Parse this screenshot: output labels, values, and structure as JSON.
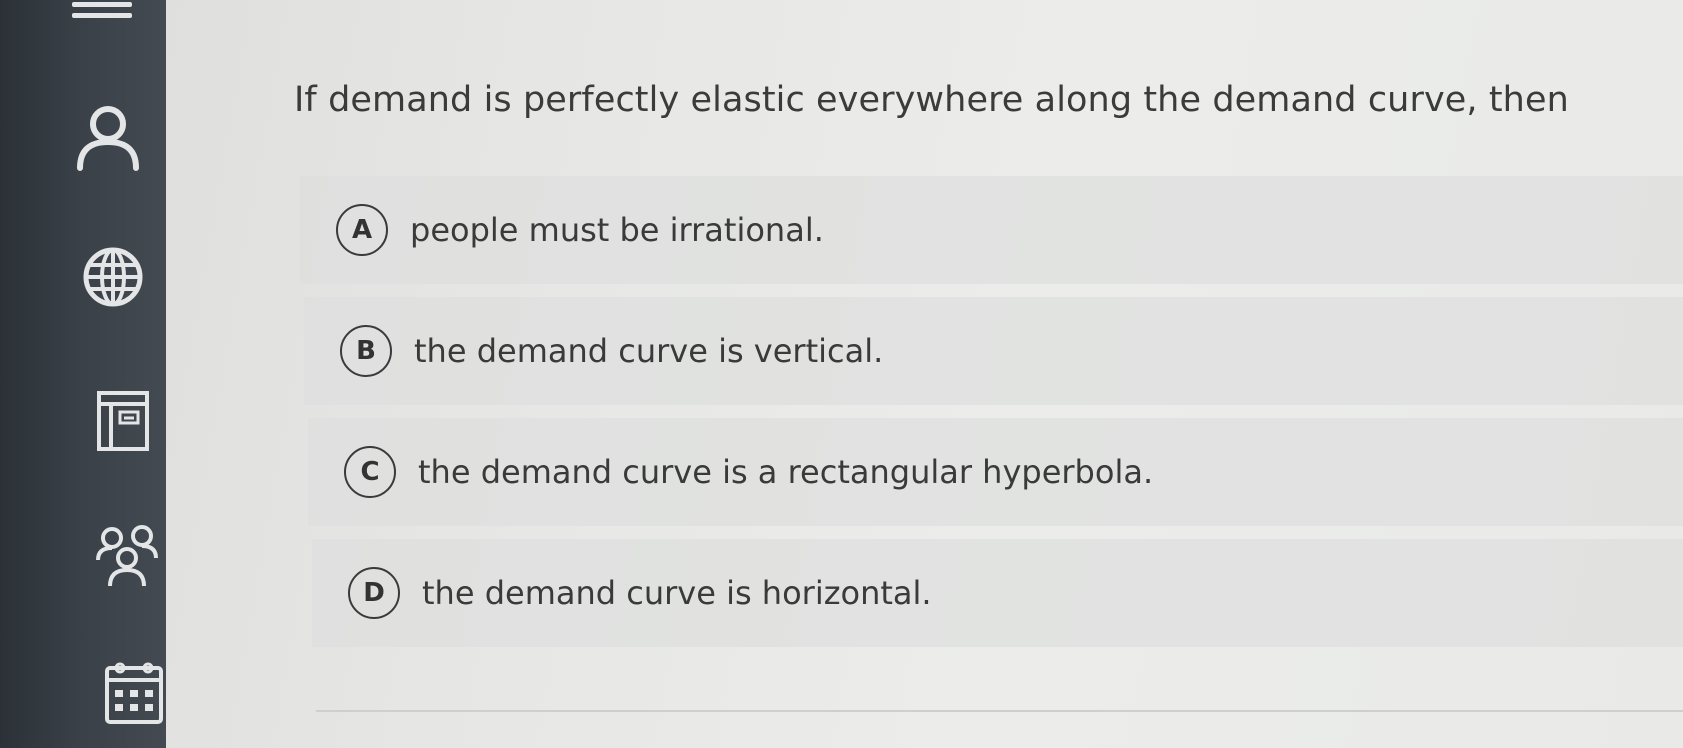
{
  "question": {
    "text": "If demand is perfectly elastic everywhere along the demand curve, then"
  },
  "options": [
    {
      "letter": "A",
      "text": "people must be irrational."
    },
    {
      "letter": "B",
      "text": "the demand curve is vertical."
    },
    {
      "letter": "C",
      "text": "the demand curve is a rectangular hyperbola."
    },
    {
      "letter": "D",
      "text": "the demand curve is horizontal."
    }
  ],
  "sidebar": {
    "icons": [
      "menu-icon",
      "account-icon",
      "globe-icon",
      "calculator-icon",
      "group-icon",
      "calendar-icon"
    ]
  },
  "colors": {
    "sidebar": "#3a4148",
    "background": "#e8e9e7",
    "text": "#3a3a3a"
  }
}
